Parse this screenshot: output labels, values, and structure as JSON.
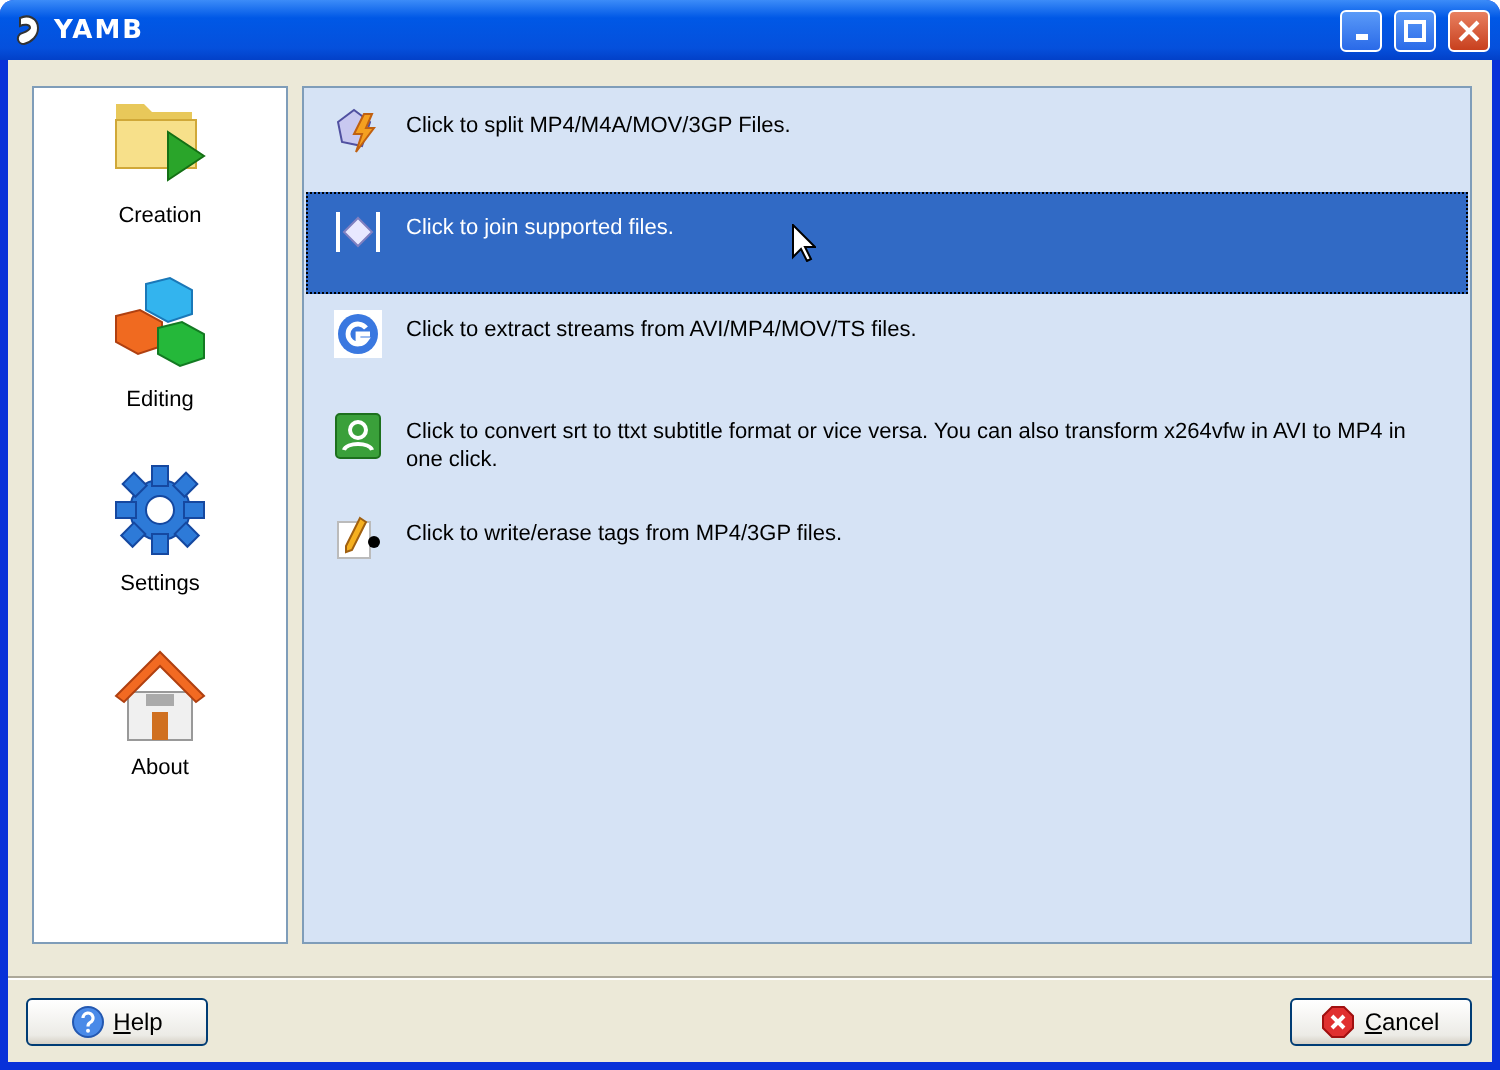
{
  "window": {
    "title": "YAMB"
  },
  "sidebar": {
    "items": [
      {
        "label": "Creation"
      },
      {
        "label": "Editing"
      },
      {
        "label": "Settings"
      },
      {
        "label": "About"
      }
    ]
  },
  "tasks": [
    {
      "text": "Click to split MP4/M4A/MOV/3GP Files.",
      "selected": false
    },
    {
      "text": "Click to join supported files.",
      "selected": true
    },
    {
      "text": "Click to extract streams from AVI/MP4/MOV/TS files.",
      "selected": false
    },
    {
      "text": "Click to convert srt to ttxt subtitle format or vice versa. You can also transform x264vfw in AVI to MP4 in one click.",
      "selected": false
    },
    {
      "text": "Click to write/erase tags from MP4/3GP files.",
      "selected": false
    }
  ],
  "buttons": [
    {
      "label": "Help",
      "kind": "help"
    },
    {
      "label": "Cancel",
      "kind": "cancel"
    }
  ]
}
